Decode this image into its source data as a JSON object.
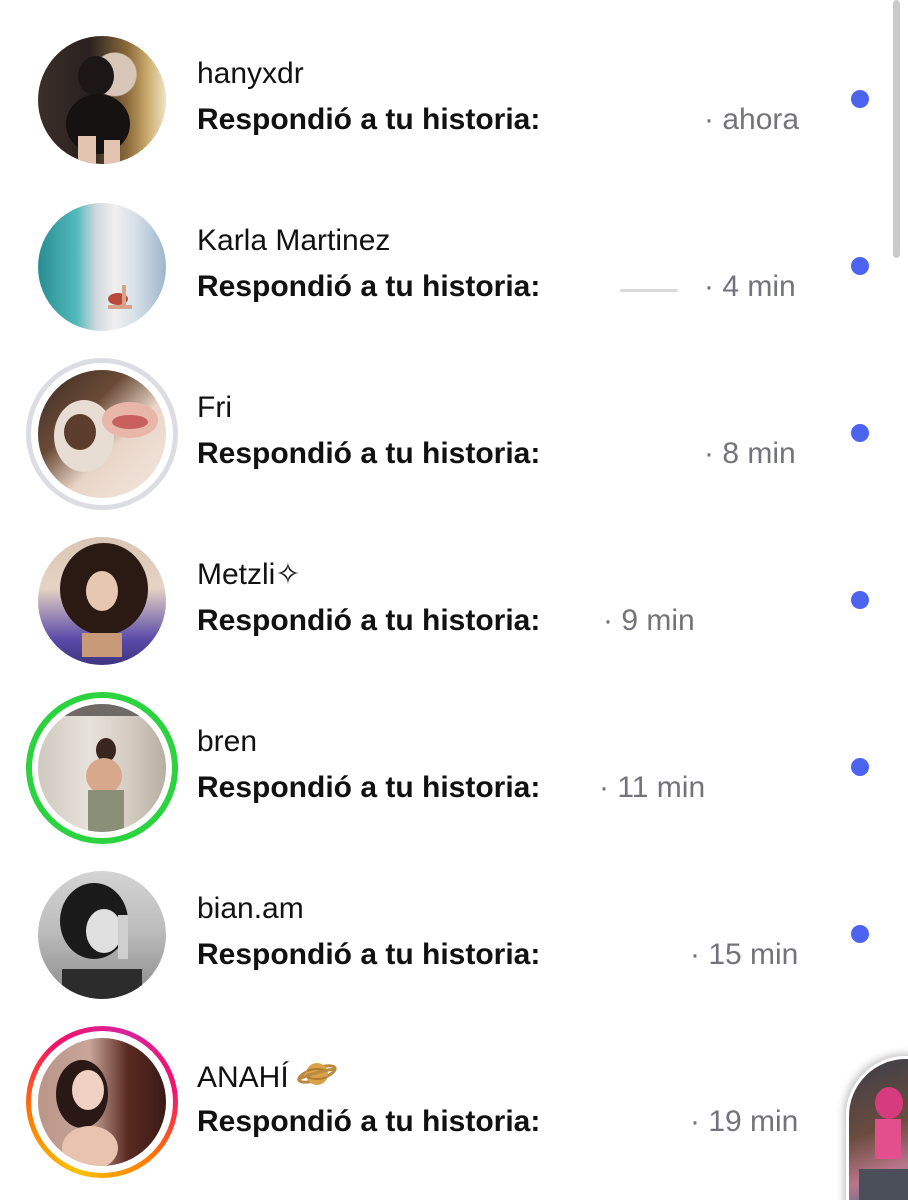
{
  "threads": [
    {
      "name": "hanyxdr",
      "preview": "Respondió a tu historia:",
      "time": "· ahora",
      "unread": true,
      "ring": "none",
      "avatar_icon": "user-photo-icon"
    },
    {
      "name": "Karla Martinez",
      "preview": "Respondió a tu historia:",
      "time": "· 4 min",
      "unread": true,
      "ring": "none",
      "avatar_icon": "user-photo-icon"
    },
    {
      "name": "Fri",
      "preview": "Respondió a tu historia:",
      "time": "· 8 min",
      "unread": true,
      "ring": "seen",
      "avatar_icon": "user-photo-icon"
    },
    {
      "name": "Metzli✧",
      "preview": "Respondió a tu historia:",
      "time": "· 9 min",
      "unread": true,
      "ring": "none",
      "avatar_icon": "user-photo-icon"
    },
    {
      "name": "bren",
      "preview": "Respondió a tu historia:",
      "time": "· 11 min",
      "unread": true,
      "ring": "close-friends",
      "avatar_icon": "user-photo-icon"
    },
    {
      "name": "bian.am",
      "preview": "Respondió a tu historia:",
      "time": "· 15 min",
      "unread": true,
      "ring": "none",
      "avatar_icon": "user-photo-icon"
    },
    {
      "name": "ANAHÍ",
      "name_emoji_icon": "ringed-planet-icon",
      "preview": "Respondió a tu historia:",
      "time": "· 19 min",
      "unread": true,
      "ring": "story",
      "avatar_icon": "user-photo-icon"
    }
  ],
  "colors": {
    "unread_dot": "#4b63ee",
    "close_friends_ring": "#2bd33f",
    "seen_ring": "#dcdde2",
    "time_text": "#73737a"
  }
}
